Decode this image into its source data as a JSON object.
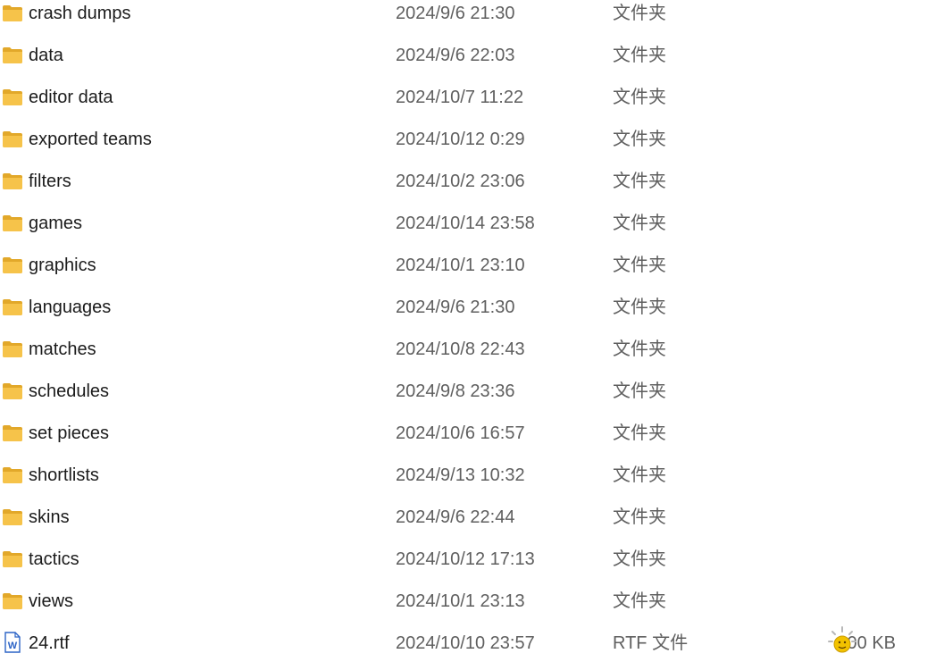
{
  "files": [
    {
      "name": "crash dumps",
      "date": "2024/9/6 21:30",
      "type": "文件夹",
      "size": "",
      "icon": "folder-icon"
    },
    {
      "name": "data",
      "date": "2024/9/6 22:03",
      "type": "文件夹",
      "size": "",
      "icon": "folder-icon"
    },
    {
      "name": "editor data",
      "date": "2024/10/7 11:22",
      "type": "文件夹",
      "size": "",
      "icon": "folder-icon"
    },
    {
      "name": "exported teams",
      "date": "2024/10/12 0:29",
      "type": "文件夹",
      "size": "",
      "icon": "folder-icon"
    },
    {
      "name": "filters",
      "date": "2024/10/2 23:06",
      "type": "文件夹",
      "size": "",
      "icon": "folder-icon"
    },
    {
      "name": "games",
      "date": "2024/10/14 23:58",
      "type": "文件夹",
      "size": "",
      "icon": "folder-icon"
    },
    {
      "name": "graphics",
      "date": "2024/10/1 23:10",
      "type": "文件夹",
      "size": "",
      "icon": "folder-icon"
    },
    {
      "name": "languages",
      "date": "2024/9/6 21:30",
      "type": "文件夹",
      "size": "",
      "icon": "folder-icon"
    },
    {
      "name": "matches",
      "date": "2024/10/8 22:43",
      "type": "文件夹",
      "size": "",
      "icon": "folder-icon"
    },
    {
      "name": "schedules",
      "date": "2024/9/8 23:36",
      "type": "文件夹",
      "size": "",
      "icon": "folder-icon"
    },
    {
      "name": "set pieces",
      "date": "2024/10/6 16:57",
      "type": "文件夹",
      "size": "",
      "icon": "folder-icon"
    },
    {
      "name": "shortlists",
      "date": "2024/9/13 10:32",
      "type": "文件夹",
      "size": "",
      "icon": "folder-icon"
    },
    {
      "name": "skins",
      "date": "2024/9/6 22:44",
      "type": "文件夹",
      "size": "",
      "icon": "folder-icon"
    },
    {
      "name": "tactics",
      "date": "2024/10/12 17:13",
      "type": "文件夹",
      "size": "",
      "icon": "folder-icon"
    },
    {
      "name": "views",
      "date": "2024/10/1 23:13",
      "type": "文件夹",
      "size": "",
      "icon": "folder-icon"
    },
    {
      "name": "24.rtf",
      "date": "2024/10/10 23:57",
      "type": "RTF 文件",
      "size": "300 KB",
      "icon": "word-document-icon"
    }
  ],
  "colors": {
    "folder": "#f6c34a",
    "folder_dark": "#e2a82a",
    "word_blue": "#2b63c6",
    "spinner": "#f2c200"
  }
}
